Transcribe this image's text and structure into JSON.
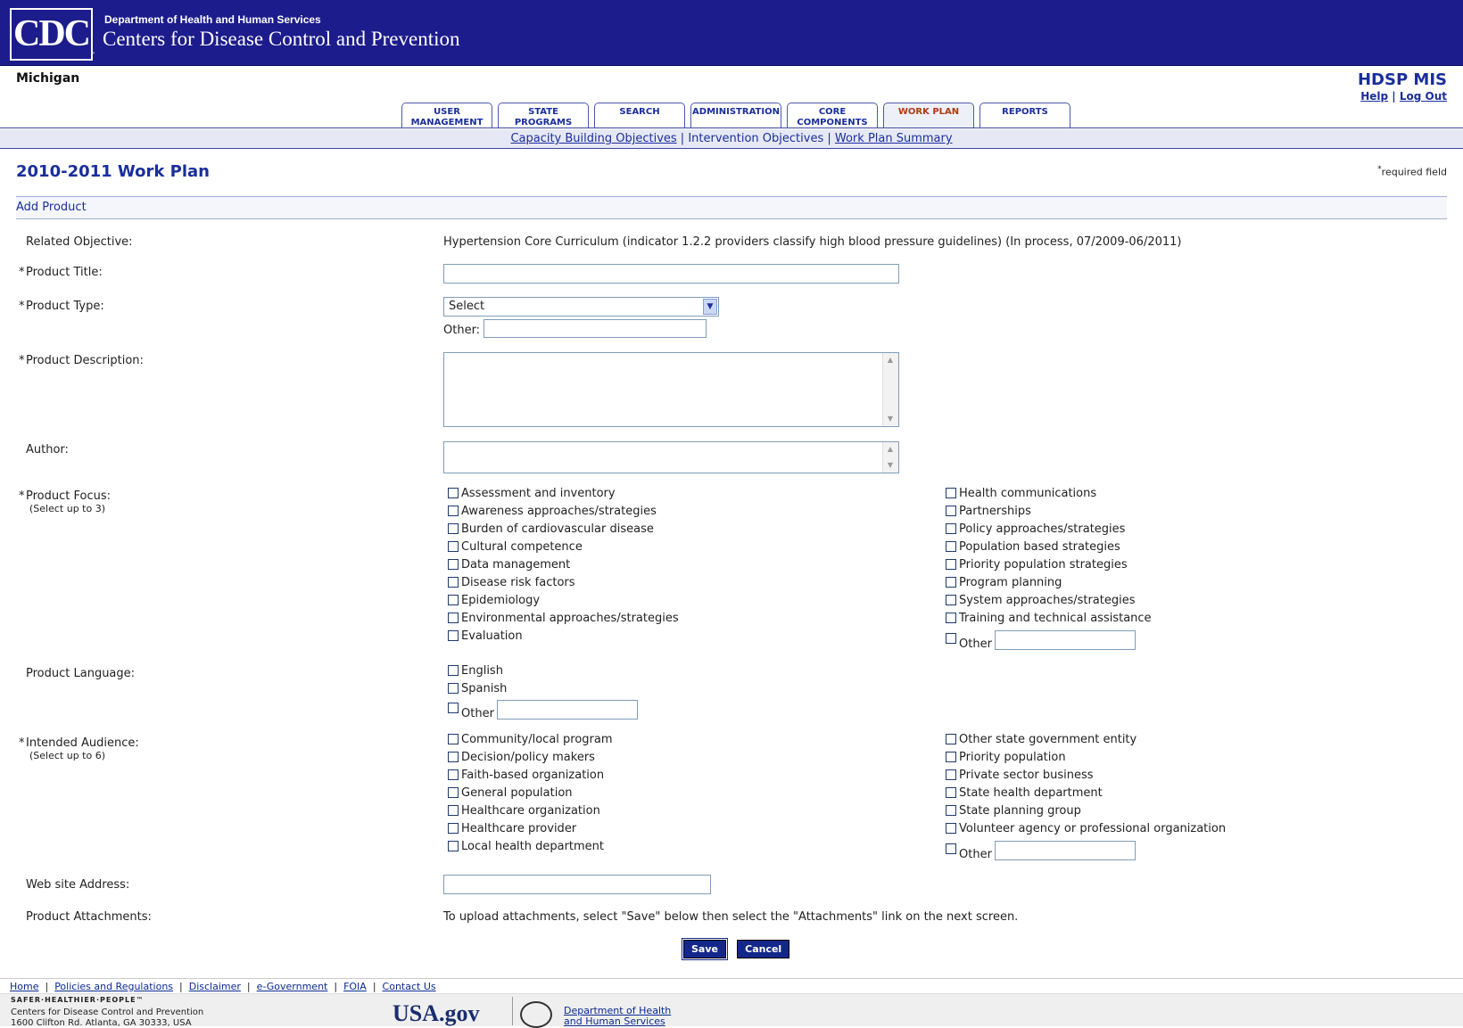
{
  "header": {
    "logo": "CDC",
    "department": "Department of Health and Human Services",
    "agency": "Centers for Disease Control and Prevention",
    "state": "Michigan",
    "app_title": "HDSP MIS",
    "help": "Help",
    "separator": "|",
    "logout": "Log Out"
  },
  "tabs": [
    {
      "label": "USER MANAGEMENT"
    },
    {
      "label": "STATE PROGRAMS"
    },
    {
      "label": "SEARCH"
    },
    {
      "label": "ADMINISTRATION"
    },
    {
      "label": "CORE COMPONENTS"
    },
    {
      "label": "WORK PLAN"
    },
    {
      "label": "REPORTS"
    }
  ],
  "subnav": {
    "capacity": "Capacity Building Objectives",
    "intervention": "Intervention Objectives",
    "summary": "Work Plan Summary"
  },
  "page": {
    "title": "2010-2011 Work Plan",
    "required_note": "required field",
    "section": "Add Product"
  },
  "form": {
    "related_objective_label": "Related Objective:",
    "related_objective_value": "Hypertension Core Curriculum (indicator 1.2.2 providers classify high blood pressure guidelines) (In process, 07/2009-06/2011)",
    "product_title_label": "Product Title:",
    "product_type_label": "Product Type:",
    "product_type_value": "Select",
    "other_label": "Other:",
    "product_description_label": "Product Description:",
    "author_label": "Author:",
    "product_focus_label": "Product Focus:",
    "product_focus_hint": "(Select up to 3)",
    "focus_left": [
      "Assessment and inventory",
      "Awareness approaches/strategies",
      "Burden of cardiovascular disease",
      "Cultural competence",
      "Data management",
      "Disease risk factors",
      "Epidemiology",
      "Environmental approaches/strategies",
      "Evaluation"
    ],
    "focus_right": [
      "Health communications",
      "Partnerships",
      "Policy approaches/strategies",
      "Population based strategies",
      "Priority population strategies",
      "Program planning",
      "System approaches/strategies",
      "Training and technical assistance"
    ],
    "other_option": "Other",
    "product_language_label": "Product Language:",
    "languages": [
      "English",
      "Spanish"
    ],
    "intended_audience_label": "Intended Audience:",
    "intended_audience_hint": "(Select up to 6)",
    "audience_left": [
      "Community/local program",
      "Decision/policy makers",
      "Faith-based organization",
      "General population",
      "Healthcare organization",
      "Healthcare provider",
      "Local health department"
    ],
    "audience_right": [
      "Other state government entity",
      "Priority population",
      "Private sector business",
      "State health department",
      "State planning group",
      "Volunteer agency or professional organization"
    ],
    "website_label": "Web site Address:",
    "attachments_label": "Product Attachments:",
    "attachments_note": "To upload attachments, select \"Save\" below then select the \"Attachments\" link on the next screen.",
    "save": "Save",
    "cancel": "Cancel"
  },
  "footer": {
    "links": [
      "Home",
      "Policies and Regulations",
      "Disclaimer",
      "e-Government",
      "FOIA",
      "Contact Us"
    ],
    "tagline": "SAFER·HEALTHIER·PEOPLE™",
    "org": "Centers for Disease Control and Prevention",
    "address": "1600 Clifton Rd. Atlanta, GA 30333, USA",
    "usagov": "USA.gov",
    "hhs_line1": "Department of Health",
    "hhs_line2": "and Human Services"
  },
  "colors": {
    "banner": "#1c1c8c",
    "accent": "#1a2e9c",
    "active_tab": "#b03a10"
  }
}
